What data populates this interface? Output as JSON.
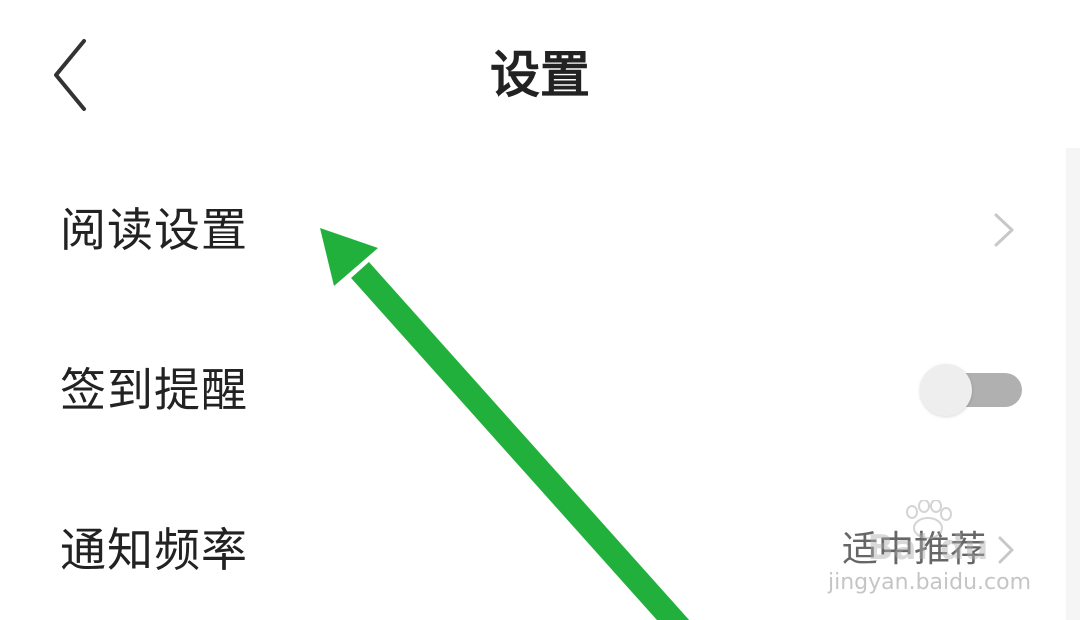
{
  "header": {
    "title": "设置",
    "back_icon": "chevron-left-icon"
  },
  "settings": {
    "reading": {
      "label": "阅读设置",
      "icon": "chevron-right-icon"
    },
    "checkin_reminder": {
      "label": "签到提醒",
      "enabled": false
    },
    "notify_frequency": {
      "label": "通知频率",
      "value": "适中推荐",
      "icon": "chevron-right-icon"
    }
  },
  "watermark": {
    "brand": "Bai du",
    "url": "jingyan.baidu.com"
  },
  "annotation": {
    "arrow_color": "#22b03c"
  },
  "colors": {
    "text": "#222222",
    "chevron": "#c8c8c8",
    "toggle_track": "#b0b0b0",
    "toggle_knob": "#eeeeee"
  }
}
